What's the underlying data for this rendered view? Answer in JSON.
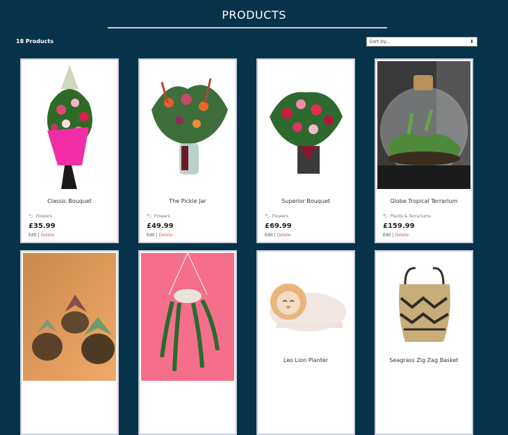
{
  "header": {
    "title": "PRODUCTS"
  },
  "toolbar": {
    "count": "18 Products",
    "sort_placeholder": "Sort by..."
  },
  "products": [
    {
      "name": "Classic Bouquet",
      "category": "Flowers",
      "price": "£35.99",
      "edit": "Edit",
      "delete": "Delete"
    },
    {
      "name": "The Pickle Jar",
      "category": "Flowers",
      "price": "£49.99",
      "edit": "Edit",
      "delete": "Delete"
    },
    {
      "name": "Superior Bouquet",
      "category": "Flowers",
      "price": "£69.99",
      "edit": "Edit",
      "delete": "Delete"
    },
    {
      "name": "Globe Tropical Terrarium",
      "category": "Plants & Terrariums",
      "price": "£159.99",
      "edit": "Edit",
      "delete": "Delete"
    },
    {
      "name": "",
      "category": "",
      "price": ""
    },
    {
      "name": "",
      "category": "",
      "price": ""
    },
    {
      "name": "Leo Lion Planter",
      "category": "",
      "price": ""
    },
    {
      "name": "Seagrass Zig Zag Basket",
      "category": "",
      "price": ""
    }
  ],
  "colors": {
    "background": "#06324a",
    "delete": "#d9534f",
    "accent_pink": "#f56f8c"
  }
}
